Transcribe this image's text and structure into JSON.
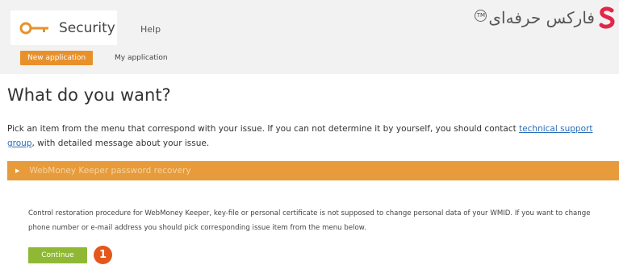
{
  "header": {
    "tabs": [
      {
        "label": "Security"
      },
      {
        "label": "Help"
      }
    ],
    "brand": {
      "text": "فارکس حرفه‌ای",
      "tm": "TM"
    }
  },
  "subnav": {
    "new_application": "New application",
    "my_application": "My application"
  },
  "main": {
    "title": "What do you want?",
    "intro_text": "Pick an item from the menu that correspond with your issue. If you can not determine it by yourself, you should contact ",
    "intro_link": "technical support group",
    "intro_tail": ", with detailed message about your issue.",
    "accordion_label": "WebMoney Keeper password recovery",
    "description": "Control restoration procedure for WebMoney Keeper, key-file or personal certificate is not supposed to change personal data of your WMID. If you want to change phone number or e-mail address you should pick corresponding issue item from the menu below.",
    "continue_label": "Continue",
    "step_number": "1"
  },
  "colors": {
    "accent_orange": "#e8912b",
    "accordion_orange": "#e79b3a",
    "continue_green": "#8fb935",
    "badge_red": "#e4571c",
    "link_blue": "#2a6ebb",
    "brand_red": "#e0284a"
  },
  "icons": {
    "security_tab": "key-icon",
    "accordion": "triangle-right-icon",
    "brand": "brand-logo-icon"
  }
}
